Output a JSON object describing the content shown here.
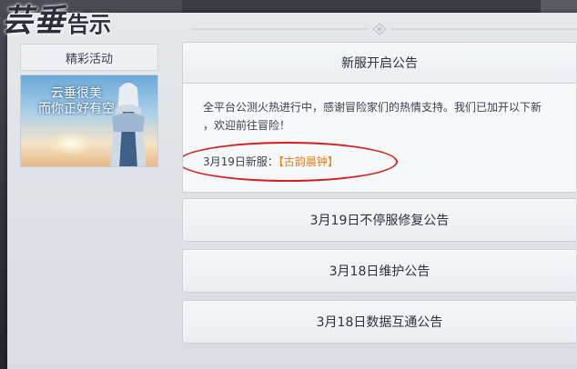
{
  "header": {
    "title_main": "芸垂",
    "title_sub": "告示"
  },
  "sidebar": {
    "category": "精彩活动",
    "banner_text_line1": "云垂很美",
    "banner_text_line2": "而你正好有空"
  },
  "notices": [
    {
      "title": "新服开启公告",
      "expanded": true,
      "body_line1": "全平台公测火热进行中，感谢冒险家们的热情支持。我们已加开以下新",
      "body_line2": "，欢迎前往冒险！",
      "date_label": "3月19日新服：",
      "server_name": "【古韵晨钟】"
    },
    {
      "title": "3月19日不停服修复公告",
      "expanded": false
    },
    {
      "title": "3月18日维护公告",
      "expanded": false
    },
    {
      "title": "3月18日数据互通公告",
      "expanded": false
    }
  ],
  "colors": {
    "highlight": "#e47c17",
    "annotation_circle": "#d41f1f"
  }
}
